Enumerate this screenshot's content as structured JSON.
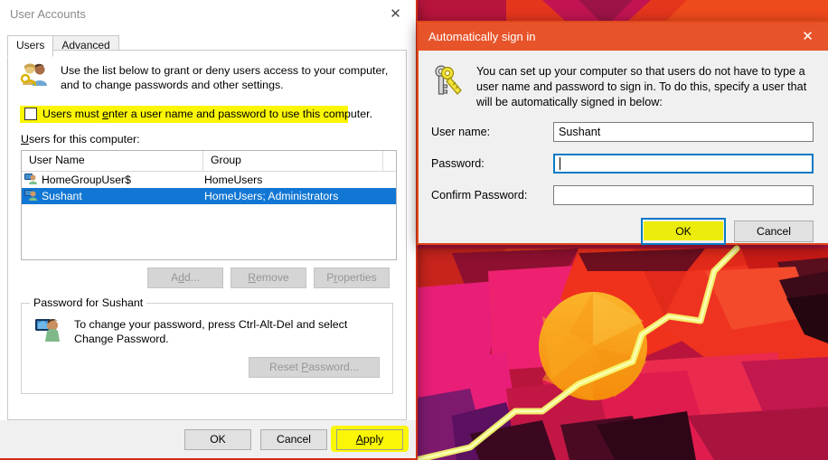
{
  "desktop": {
    "wallpaper_name": "abstract-lowpoly-wallpaper",
    "colors": {
      "red": "#e8361c",
      "orange": "#f07818",
      "pink": "#e81e78",
      "magenta": "#c21744",
      "dark_maroon": "#6b0d2c",
      "lightning": "#e8f56a",
      "sun": "#f7a81b"
    }
  },
  "user_accounts_dialog": {
    "title": "User Accounts",
    "close_label": "✕",
    "accent_border": "#d13018",
    "tabs": [
      {
        "label": "Users",
        "active": true
      },
      {
        "label": "Advanced",
        "active": false
      }
    ],
    "intro_text": "Use the list below to grant or deny users access to your computer, and to change passwords and other settings.",
    "checkbox": {
      "label_before": "Users must ",
      "label_accel": "e",
      "label_after": "nter a user name and password to use this computer.",
      "checked": false,
      "highlighted": true,
      "highlight_color": "#fbf605"
    },
    "list_caption_accel": "U",
    "list_caption_rest": "sers for this computer:",
    "list": {
      "columns": [
        "User Name",
        "Group"
      ],
      "rows": [
        {
          "user": "HomeGroupUser$",
          "group": "HomeUsers",
          "selected": false
        },
        {
          "user": "Sushant",
          "group": "HomeUsers; Administrators",
          "selected": true
        }
      ]
    },
    "list_buttons": [
      {
        "label_pre": "A",
        "label_accel": "d",
        "label_post": "d...",
        "enabled": false
      },
      {
        "label_pre": "",
        "label_accel": "R",
        "label_post": "emove",
        "enabled": false
      },
      {
        "label_pre": "P",
        "label_accel": "r",
        "label_post": "operties",
        "enabled": false
      }
    ],
    "password_group": {
      "title": "Password for Sushant",
      "text": "To change your password, press Ctrl-Alt-Del and select Change Password.",
      "button": {
        "label_pre": "Reset ",
        "label_accel": "P",
        "label_post": "assword...",
        "enabled": false
      }
    },
    "footer_buttons": [
      {
        "name": "ok",
        "label": "OK",
        "highlighted": false
      },
      {
        "name": "cancel",
        "label": "Cancel",
        "highlighted": false
      },
      {
        "name": "apply",
        "label_pre": "",
        "label_accel": "A",
        "label_post": "pply",
        "highlighted": true
      }
    ]
  },
  "signin_dialog": {
    "title": "Automatically sign in",
    "close_label": "✕",
    "titlebar_color": "#e8542a",
    "intro_text": "You can set up your computer so that users do not have to type a user name and password to sign in. To do this, specify a user that will be automatically signed in below:",
    "fields": [
      {
        "name": "user-name",
        "label": "User name:",
        "value": "Sushant",
        "focused": false
      },
      {
        "name": "password",
        "label": "Password:",
        "value": "",
        "focused": true
      },
      {
        "name": "confirm-password",
        "label": "Confirm Password:",
        "value": "",
        "focused": false
      }
    ],
    "buttons": [
      {
        "name": "ok",
        "label": "OK",
        "focused": true,
        "highlighted": true
      },
      {
        "name": "cancel",
        "label": "Cancel",
        "focused": false,
        "highlighted": false
      }
    ]
  }
}
